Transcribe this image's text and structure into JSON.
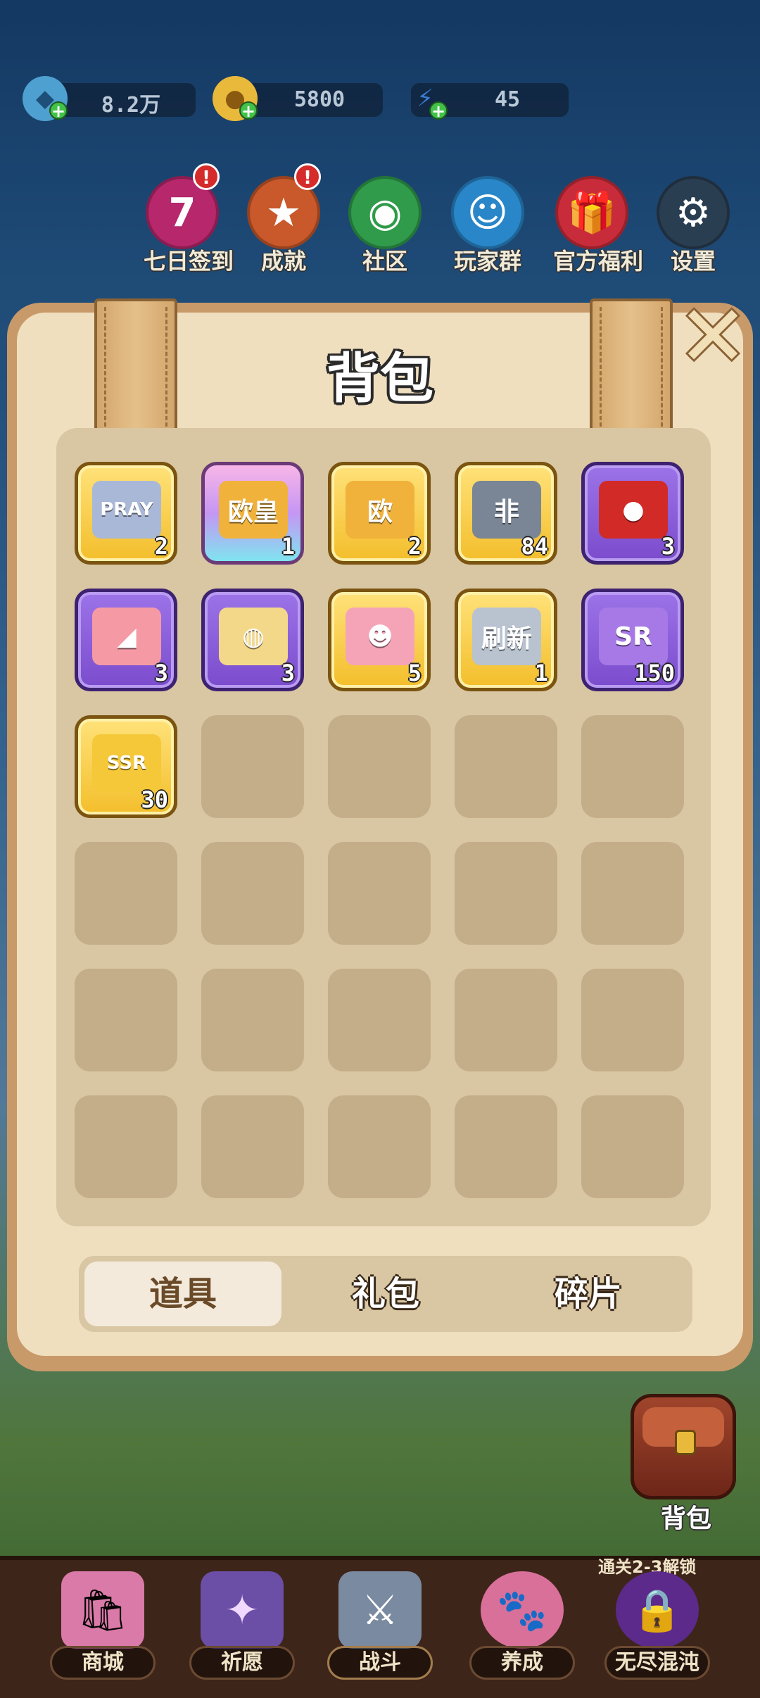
{
  "resources": [
    {
      "icon": "gem-icon",
      "value": "8.2万"
    },
    {
      "icon": "coin-icon",
      "value": "5800"
    },
    {
      "icon": "lightning-icon",
      "value": "45"
    }
  ],
  "top_menu": [
    {
      "name": "seven-day-signin",
      "label": "七日签到",
      "glyph": "7",
      "color": "#b6276b",
      "badge": "!"
    },
    {
      "name": "achievement",
      "label": "成就",
      "glyph": "★",
      "color": "#c9582a",
      "badge": "!"
    },
    {
      "name": "community",
      "label": "社区",
      "glyph": "◉",
      "color": "#2f9b4b",
      "badge": ""
    },
    {
      "name": "player-group",
      "label": "玩家群",
      "glyph": "☺",
      "color": "#2986c8",
      "badge": ""
    },
    {
      "name": "official-welfare",
      "label": "官方福利",
      "glyph": "🎁",
      "color": "#c82c3a",
      "badge": ""
    },
    {
      "name": "settings",
      "label": "设置",
      "glyph": "⚙",
      "color": "#2a3e52",
      "badge": ""
    }
  ],
  "panel": {
    "title": "背包",
    "close": "✕"
  },
  "items": [
    {
      "name": "pray-ticket",
      "frame": "gold",
      "art_text": "PRAY",
      "art_color": "#aab8d8",
      "count": "2"
    },
    {
      "name": "ouhuang-ticket",
      "frame": "pinkrare",
      "art_text": "欧皇",
      "art_color": "#f0b23a",
      "count": "1"
    },
    {
      "name": "ou-ticket",
      "frame": "gold",
      "art_text": "欧",
      "art_color": "#f0b23a",
      "count": "2"
    },
    {
      "name": "fei-ticket",
      "frame": "gold",
      "art_text": "非",
      "art_color": "#7a8695",
      "count": "84"
    },
    {
      "name": "apple",
      "frame": "purple",
      "art_text": "●",
      "art_color": "#d22a26",
      "count": "3"
    },
    {
      "name": "cake",
      "frame": "purple",
      "art_text": "◢",
      "art_color": "#f59aa4",
      "count": "3"
    },
    {
      "name": "chips",
      "frame": "purple",
      "art_text": "◍",
      "art_color": "#f4d88a",
      "count": "3"
    },
    {
      "name": "ghost-ticket",
      "frame": "gold",
      "art_text": "☻",
      "art_color": "#f5a4b8",
      "count": "5"
    },
    {
      "name": "refresh-ticket",
      "frame": "gold",
      "art_text": "刷新",
      "art_color": "#b9c2cf",
      "count": "1"
    },
    {
      "name": "sr-fragment",
      "frame": "purple",
      "art_text": "SR",
      "art_color": "#a679e6",
      "count": "150"
    },
    {
      "name": "ssr-fragment",
      "frame": "gold",
      "art_text": "SSR",
      "art_color": "#f5c83a",
      "count": "30"
    }
  ],
  "tabs": [
    {
      "label": "道具",
      "active": true
    },
    {
      "label": "礼包",
      "active": false
    },
    {
      "label": "碎片",
      "active": false
    }
  ],
  "backpack_button": {
    "label": "背包"
  },
  "unlock_note": "通关2-3解锁",
  "bottom_nav": [
    {
      "name": "shop",
      "label": "商城",
      "glyph": "🛍",
      "color": "#d97aa8"
    },
    {
      "name": "wish",
      "label": "祈愿",
      "glyph": "✦",
      "color": "#6b4ea6"
    },
    {
      "name": "battle",
      "label": "战斗",
      "glyph": "⚔",
      "color": "#7a8aa0"
    },
    {
      "name": "nurture",
      "label": "养成",
      "glyph": "🐾",
      "color": "#d9709a"
    },
    {
      "name": "endless-chaos",
      "label": "无尽混沌",
      "glyph": "🔒",
      "color": "#5b2a8a"
    }
  ]
}
